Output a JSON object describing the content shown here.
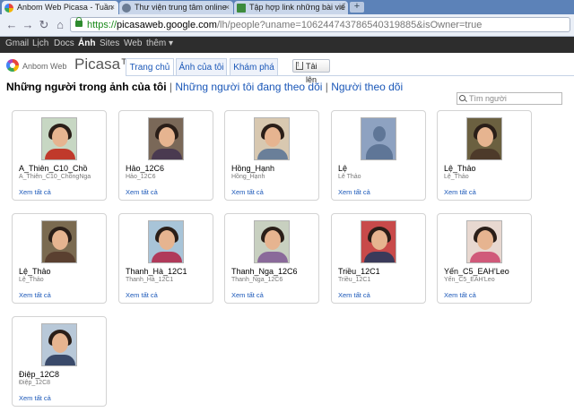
{
  "browser": {
    "tabs": [
      {
        "title": "Anbom Web Picasa - Tuần",
        "favicon_color": "#e8453c"
      },
      {
        "title": "Thư viện trung tâm online",
        "favicon_color": "#6b7c93"
      },
      {
        "title": "Tập hợp link những bài viế",
        "favicon_color": "#3d8b3d",
        "favicon_text": "GPE"
      }
    ],
    "new_tab": "+",
    "url": {
      "scheme": "https://",
      "host": "picasaweb.google.com",
      "path": "/lh/people?uname=106244743786540319885&isOwner=true"
    }
  },
  "google_bar": [
    "Gmail",
    "Lịch",
    "Docs",
    "Ảnh",
    "Sites",
    "Web",
    "thêm ▾"
  ],
  "picasa": {
    "logo_small": "Anbom Web",
    "logo_big": "Picasa™",
    "tabs": [
      "Trang chủ",
      "Ảnh của tôi",
      "Khám phá"
    ],
    "upload": "Tải lên"
  },
  "page": {
    "title": "Những người trong ảnh của tôi",
    "link1": "Những người tôi đang theo dõi",
    "link2": "Người theo dõi",
    "search_placeholder": "Tìm người"
  },
  "people": [
    {
      "name": "A_Thiên_C10_Chồ",
      "sub": "A_Thiên_C10_ChồngNga",
      "link": "Xem tất cả"
    },
    {
      "name": "Hảo_12C6",
      "sub": "Hảo_12C6",
      "link": "Xem tất cả"
    },
    {
      "name": "Hồng_Hạnh",
      "sub": "Hồng_Hạnh",
      "link": "Xem tất cả"
    },
    {
      "name": "Lệ",
      "sub": "Lê Thảo",
      "link": "Xem tất cả"
    },
    {
      "name": "Lệ_Thảo",
      "sub": "Lệ_Thảo",
      "link": "Xem tất cả"
    },
    {
      "name": "Lệ_Thảo",
      "sub": "Lệ_Thảo",
      "link": "Xem tất cả"
    },
    {
      "name": "Thanh_Hà_12C1",
      "sub": "Thanh_Hà_12C1",
      "link": "Xem tất cả"
    },
    {
      "name": "Thanh_Nga_12C6",
      "sub": "Thanh_Nga_12C6",
      "link": "Xem tất cả"
    },
    {
      "name": "Triều_12C1",
      "sub": "Triều_12C1",
      "link": "Xem tất cả"
    },
    {
      "name": "Yến_C5_EAH'Leo",
      "sub": "Yến_C5_EAH'Leo",
      "link": "Xem tất cả"
    },
    {
      "name": "Điệp_12C8",
      "sub": "Điệp_12C8",
      "link": "Xem tất cả"
    }
  ]
}
